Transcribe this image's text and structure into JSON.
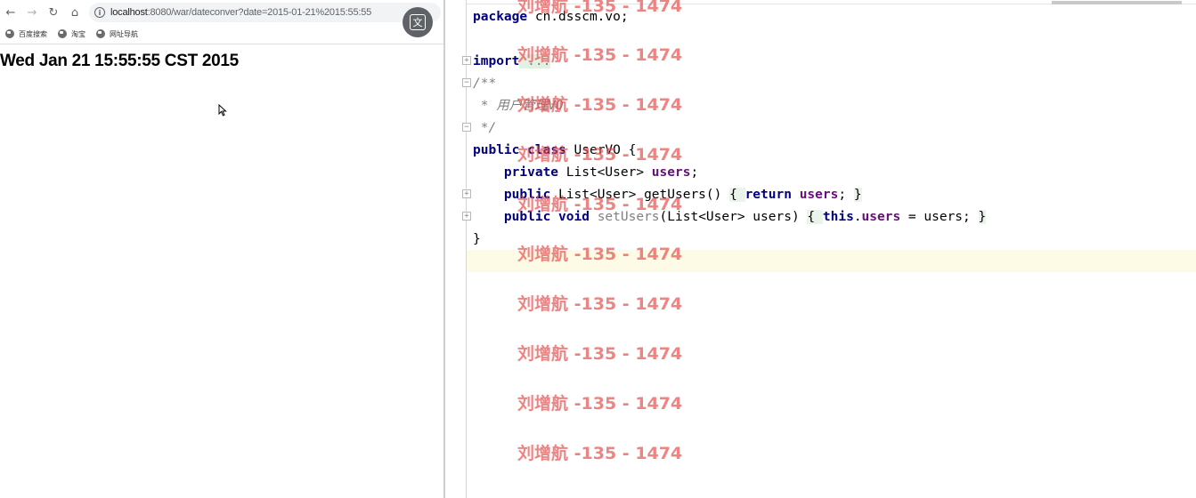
{
  "browser": {
    "nav": {
      "back_icon": "back-arrow-icon",
      "forward_icon": "forward-arrow-icon",
      "reload_icon": "reload-icon",
      "home_icon": "home-icon"
    },
    "address": {
      "host": "localhost",
      "rest": ":8080/war/dateconver?date=2015-01-21%2015:55:55"
    },
    "translate_icon": "translate-icon",
    "bookmarks": [
      {
        "label": "百度搜索",
        "icon": "globe-icon"
      },
      {
        "label": "淘宝",
        "icon": "globe-icon"
      },
      {
        "label": "网址导航",
        "icon": "globe-icon"
      }
    ],
    "page_text": "Wed Jan 21 15:55:55 CST 2015"
  },
  "editor": {
    "lines": {
      "package_kw": "package",
      "package_name": " cn.dsscm.vo;",
      "import_kw": "import",
      "import_fold": " ...",
      "doc_open": "/**",
      "doc_body": " * 用户管理VO",
      "doc_close": " */",
      "class_kw1": "public",
      "class_kw2": "class",
      "class_name": " UserVO {",
      "field_kw": "private",
      "field_type": " List<User> ",
      "field_name": "users",
      "field_end": ";",
      "getter_kw": "public",
      "getter_sig": " List<User> getUsers() ",
      "getter_open": "{ ",
      "getter_return": "return",
      "getter_field": "users",
      "getter_end": "; ",
      "getter_close": "}",
      "setter_kw1": "public",
      "setter_kw2": "void",
      "setter_name": "setUsers",
      "setter_params": "(List<User> users) ",
      "setter_open": "{ ",
      "setter_this": "this",
      "setter_dot": ".",
      "setter_field": "users",
      "setter_assign": " = users; ",
      "setter_close": "}",
      "class_close": "}"
    }
  },
  "watermark": {
    "text": "刘增航 -135 - 1474"
  }
}
